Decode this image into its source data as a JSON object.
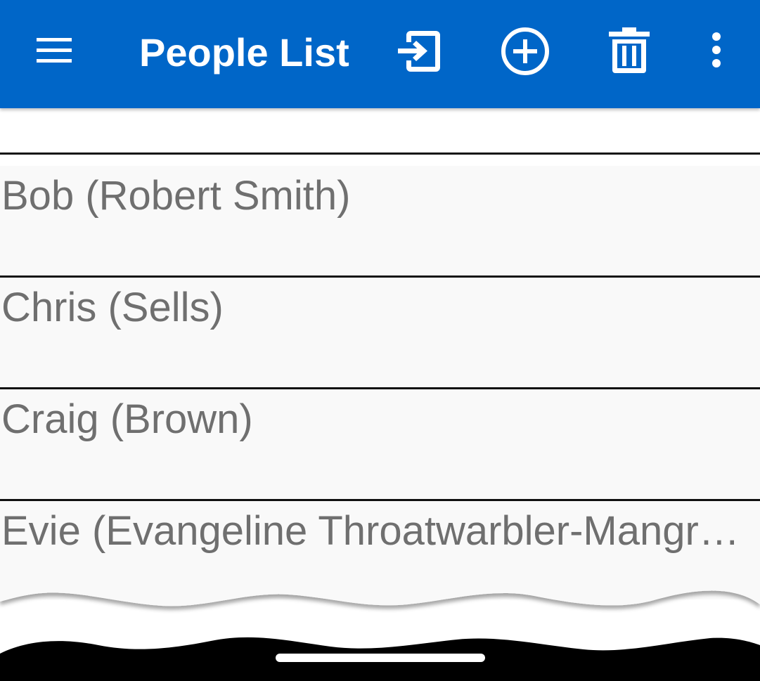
{
  "app_bar": {
    "title": "People List",
    "background_color": "#0066C8",
    "icons": [
      "menu-icon",
      "login-icon",
      "add-circle-icon",
      "delete-icon",
      "more-vert-icon"
    ]
  },
  "people": [
    {
      "label": "Bob (Robert Smith)"
    },
    {
      "label": "Chris (Sells)"
    },
    {
      "label": "Craig (Brown)"
    },
    {
      "label": "Evie (Evangeline Throatwarbler-Mangrove)"
    }
  ],
  "colors": {
    "list_text": "#6F6F6F",
    "list_background": "#F9F9F9",
    "divider": "#111111"
  }
}
